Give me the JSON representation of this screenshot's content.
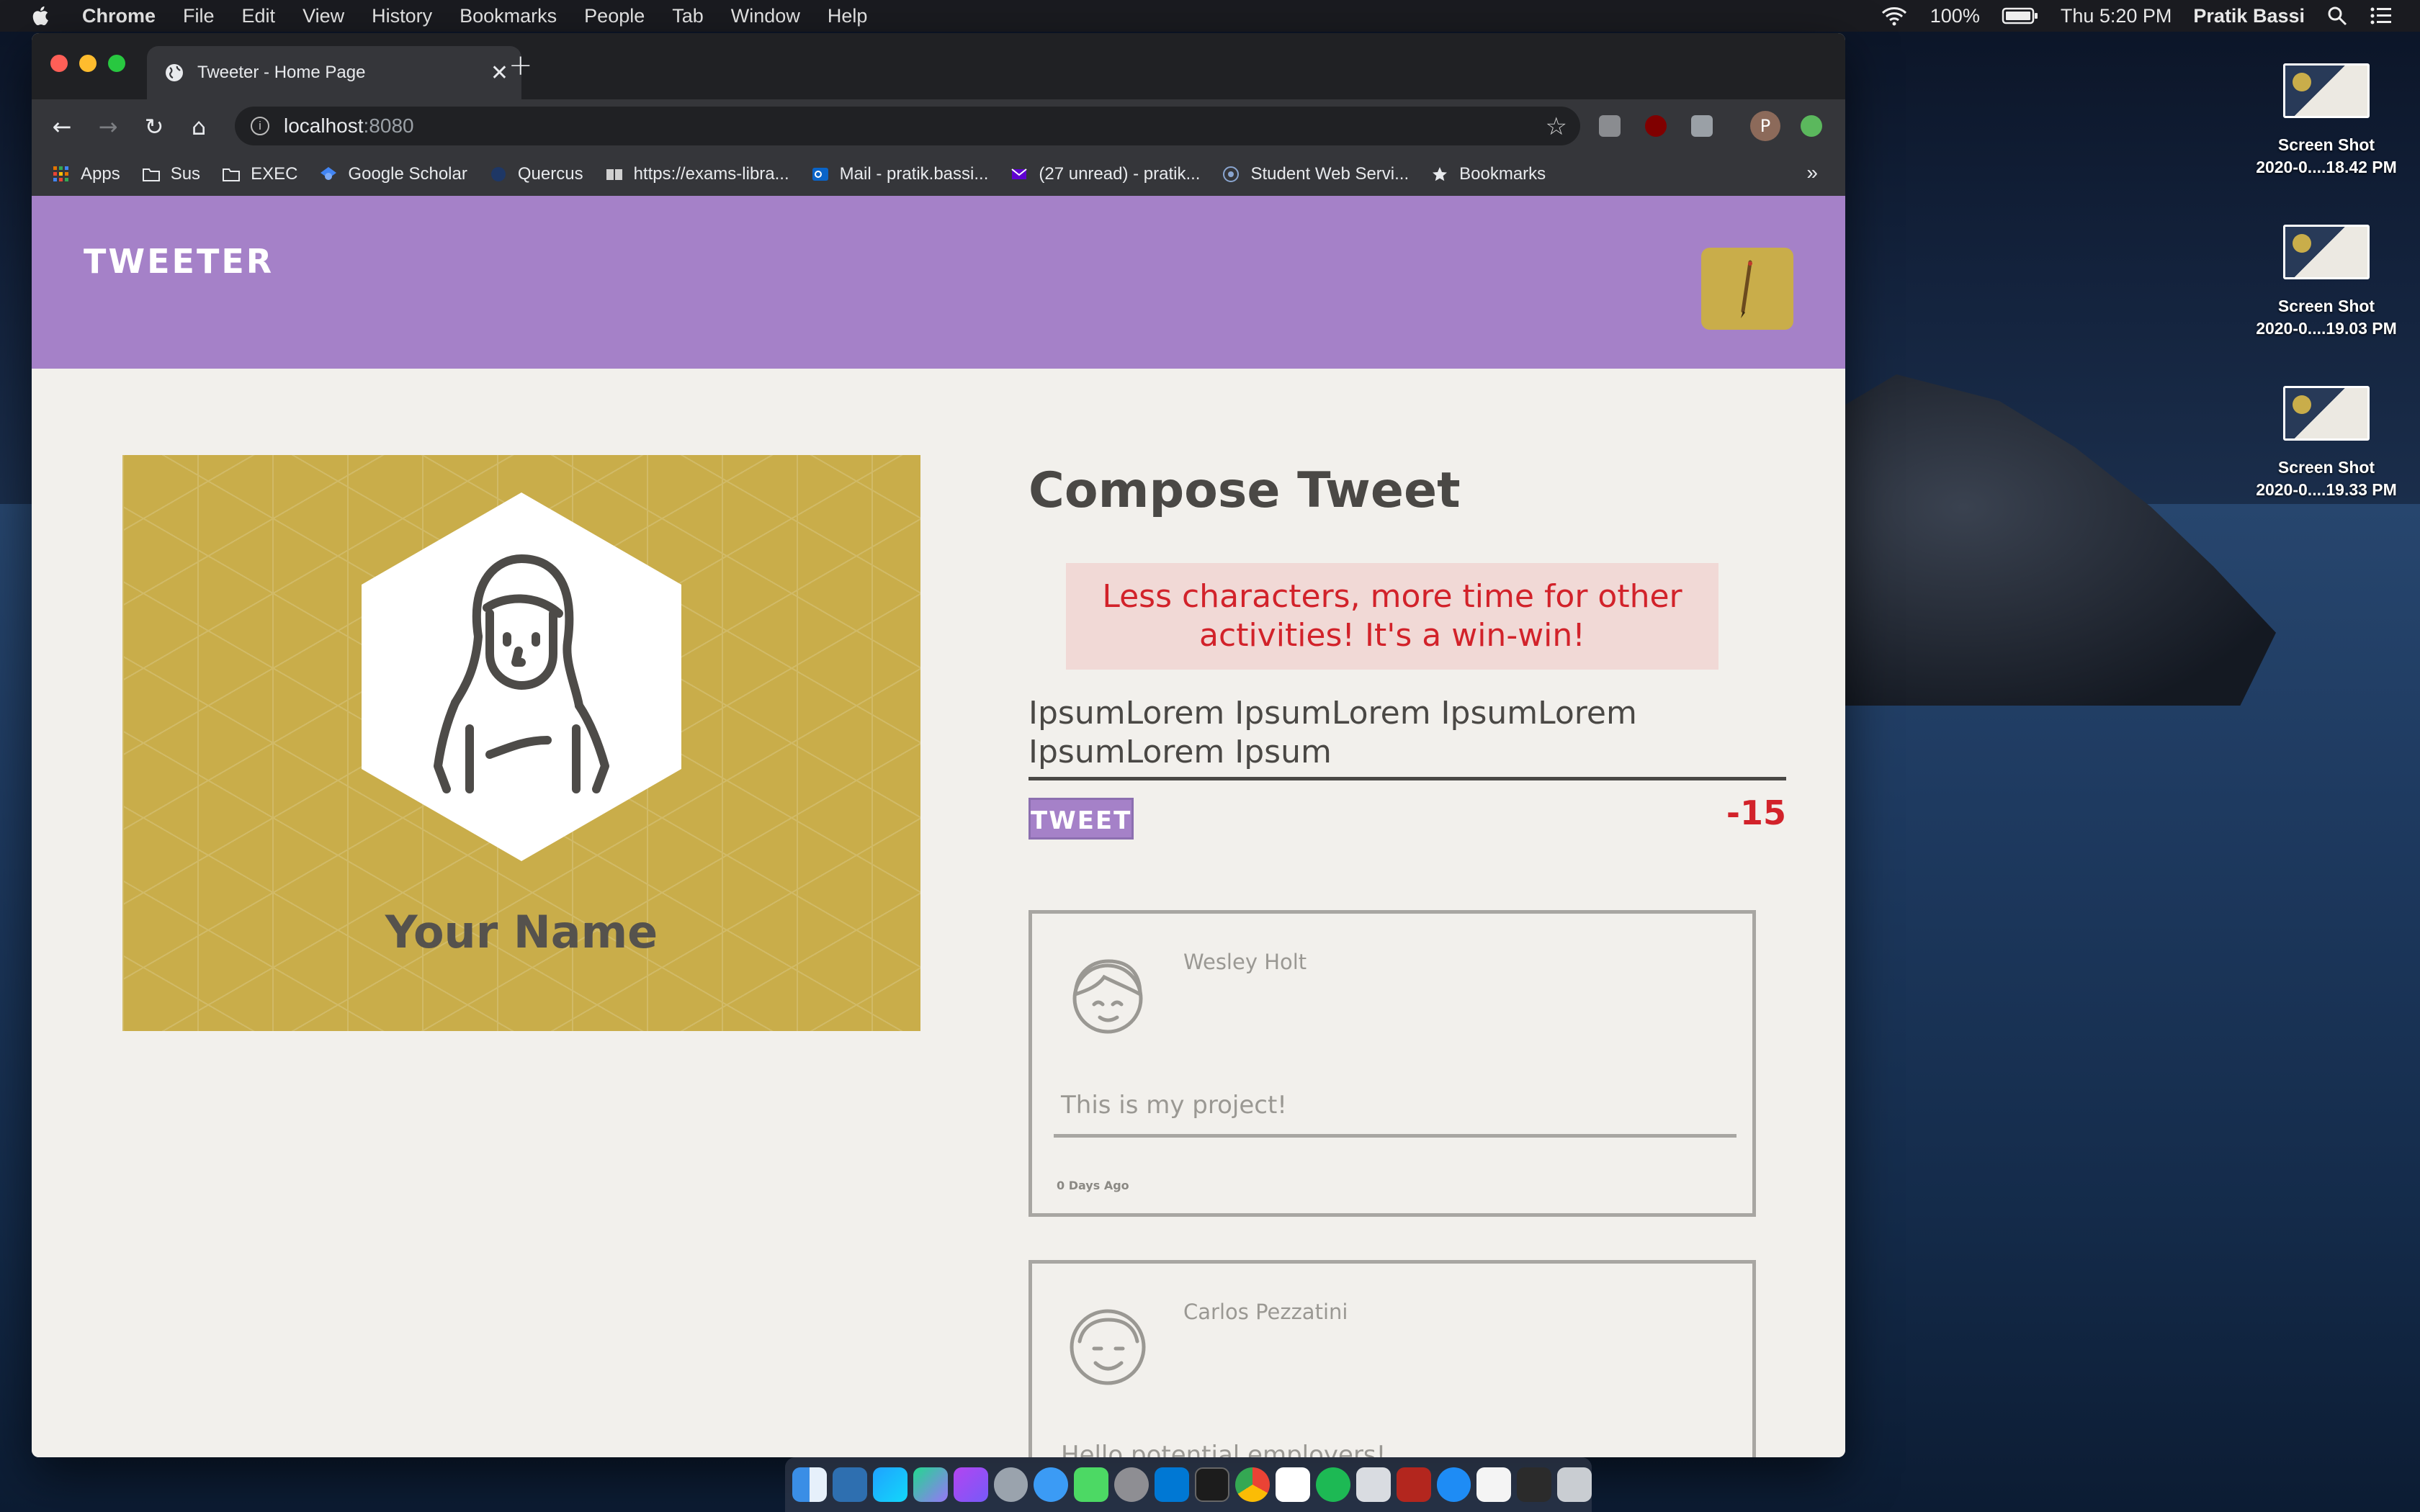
{
  "menubar": {
    "app_name": "Chrome",
    "items": [
      "File",
      "Edit",
      "View",
      "History",
      "Bookmarks",
      "People",
      "Tab",
      "Window",
      "Help"
    ],
    "battery": "100%",
    "clock": "Thu 5:20 PM",
    "user": "Pratik Bassi"
  },
  "desktop": {
    "files": [
      {
        "line1": "Screen Shot",
        "line2": "2020-0....18.42 PM"
      },
      {
        "line1": "Screen Shot",
        "line2": "2020-0....19.03 PM"
      },
      {
        "line1": "Screen Shot",
        "line2": "2020-0....19.33 PM"
      }
    ]
  },
  "browser": {
    "tab_title": "Tweeter - Home Page",
    "url_host": "localhost",
    "url_port": ":8080",
    "profile_initial": "P",
    "bookmarks": [
      "Apps",
      "Sus",
      "EXEC",
      "Google Scholar",
      "Quercus",
      "https://exams-libra...",
      "Mail - pratik.bassi...",
      "(27 unread) - pratik...",
      "Student Web Servi...",
      "Bookmarks"
    ],
    "bookmarks_overflow": "»"
  },
  "page": {
    "brand": "Tweeter",
    "profile": {
      "name": "Your Name"
    },
    "compose": {
      "title": "Compose Tweet",
      "error": "Less characters, more time for other activities! It's a win-win!",
      "text": "IpsumLorem IpsumLorem IpsumLorem IpsumLorem Ipsum",
      "button": "Tweet",
      "counter": "-15"
    },
    "tweets": [
      {
        "author": "Wesley Holt",
        "body": "This is my project!",
        "ago": "0 Days Ago"
      },
      {
        "author": "Carlos Pezzatini",
        "body": "Hello potential employers!"
      }
    ]
  },
  "colors": {
    "nav": "#a581c8",
    "gold": "#c9ad4a",
    "error_text": "#d2222a",
    "error_bg": "#f1d9d6"
  }
}
